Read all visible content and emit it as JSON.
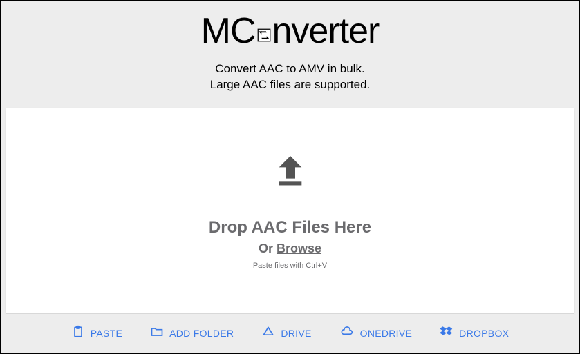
{
  "logo": {
    "left": "MC",
    "right": "nverter"
  },
  "subtitle_line1": "Convert AAC to AMV in bulk.",
  "subtitle_line2": "Large AAC files are supported.",
  "dropzone": {
    "title": "Drop AAC Files Here",
    "or": "Or ",
    "browse": "Browse",
    "hint": "Paste files with Ctrl+V"
  },
  "footer": {
    "paste": "PASTE",
    "add_folder": "ADD FOLDER",
    "drive": "DRIVE",
    "onedrive": "ONEDRIVE",
    "dropbox": "DROPBOX"
  }
}
